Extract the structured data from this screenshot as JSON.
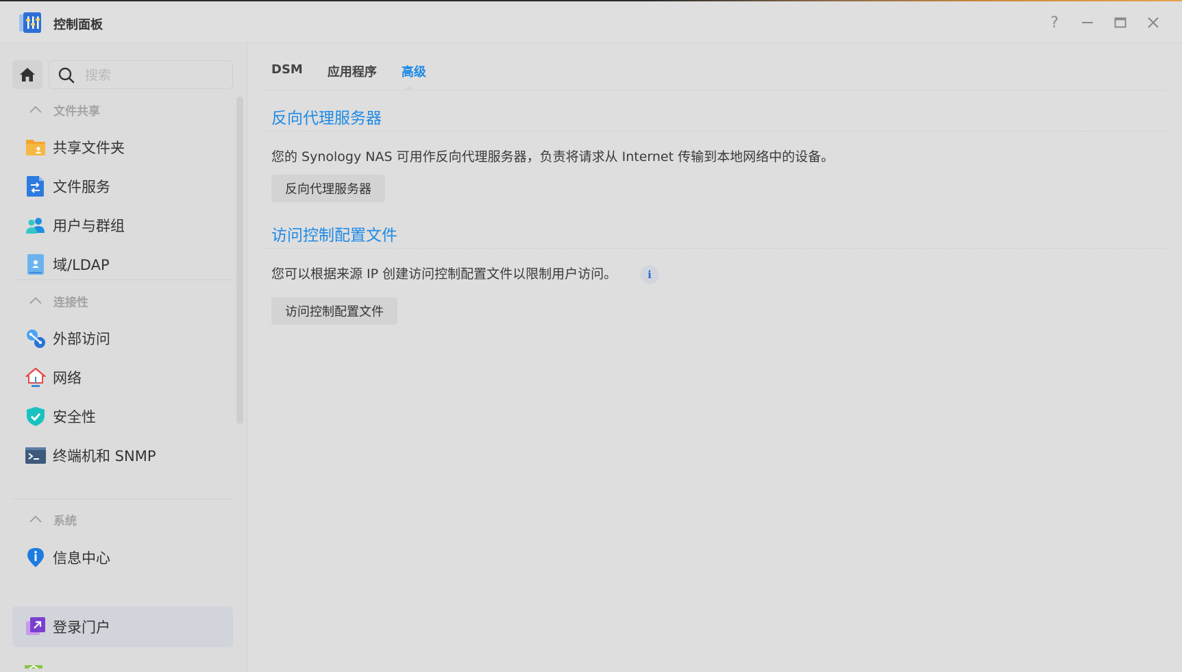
{
  "app": {
    "title": "控制面板",
    "icon": "control-panel-icon"
  },
  "window_controls": {
    "help": "?",
    "minimize": "minimize-icon",
    "maximize": "maximize-icon",
    "close": "close-icon"
  },
  "search": {
    "placeholder": "搜索",
    "value": ""
  },
  "sidebar": {
    "groups": [
      {
        "title": "文件共享",
        "items": [
          {
            "label": "共享文件夹",
            "icon": "shared-folder-icon"
          },
          {
            "label": "文件服务",
            "icon": "file-services-icon"
          },
          {
            "label": "用户与群组",
            "icon": "users-groups-icon"
          },
          {
            "label": "域/LDAP",
            "icon": "domain-ldap-icon"
          }
        ]
      },
      {
        "title": "连接性",
        "items": [
          {
            "label": "外部访问",
            "icon": "external-access-icon"
          },
          {
            "label": "网络",
            "icon": "network-icon"
          },
          {
            "label": "安全性",
            "icon": "security-shield-icon"
          },
          {
            "label": "终端机和 SNMP",
            "icon": "terminal-icon"
          }
        ]
      },
      {
        "title": "系统",
        "items": [
          {
            "label": "信息中心",
            "icon": "info-center-icon"
          },
          {
            "label": "登录门户",
            "icon": "login-portal-icon",
            "active": true
          }
        ]
      }
    ]
  },
  "tabs": [
    {
      "label": "DSM"
    },
    {
      "label": "应用程序"
    },
    {
      "label": "高级",
      "active": true
    }
  ],
  "sections": [
    {
      "title": "反向代理服务器",
      "description": "您的 Synology NAS 可用作反向代理服务器，负责将请求从 Internet 传输到本地网络中的设备。",
      "button": "反向代理服务器"
    },
    {
      "title": "访问控制配置文件",
      "description": "您可以根据来源 IP 创建访问控制配置文件以限制用户访问。",
      "button": "访问控制配置文件",
      "info_icon": "i"
    }
  ],
  "colors": {
    "accent": "#1e8ae6",
    "window_bg": "#dedede",
    "active_item_bg": "#d1d4da"
  }
}
